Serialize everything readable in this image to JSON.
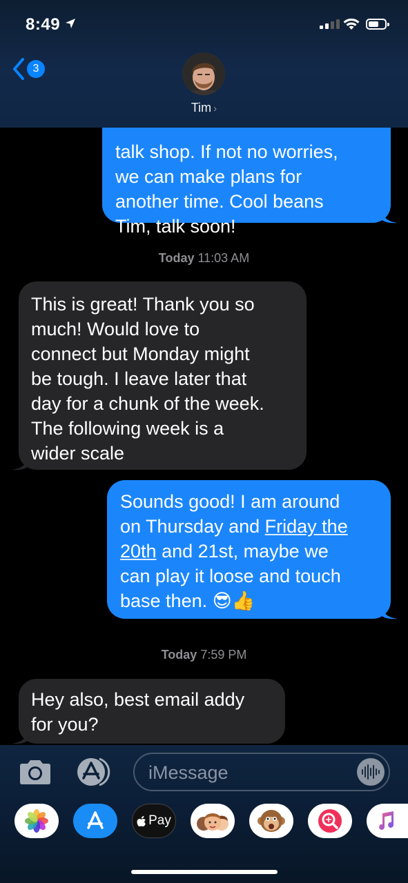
{
  "status": {
    "time": "8:49"
  },
  "header": {
    "back_count": "3",
    "contact_name": "Tim",
    "chevron": "›"
  },
  "messages": {
    "m1": {
      "lines": [
        "talk shop. If not no worries,",
        "we can make plans for",
        "another time. Cool beans",
        "Tim, talk soon!"
      ]
    },
    "ts1": {
      "label": "Today",
      "time": " 11:03 AM"
    },
    "m2": {
      "lines": [
        "This is great! Thank you so",
        "much! Would love to",
        "connect but Monday might",
        "be tough. I leave later that",
        "day for a chunk of the week.",
        "The following week is a",
        "wider scale"
      ]
    },
    "m3": {
      "line1": "Sounds good! I am around",
      "line2_a": "on Thursday and ",
      "line2_link": "Friday the",
      "line3_link": "20th",
      "line3_b": " and 21st, maybe we",
      "line4": "can play it loose and touch",
      "line5": "base then. 😎👍"
    },
    "ts2": {
      "label": "Today",
      "time": " 7:59 PM"
    },
    "m4": {
      "lines": [
        "Hey also, best email addy",
        "for you?"
      ]
    }
  },
  "composer": {
    "placeholder": "iMessage"
  },
  "app_tray": {
    "items": [
      {
        "icon": "photos-icon"
      },
      {
        "icon": "app-store-icon"
      },
      {
        "icon": "apple-pay-icon",
        "label": "Pay"
      },
      {
        "icon": "memoji-icon"
      },
      {
        "icon": "animoji-monkey-icon"
      },
      {
        "icon": "gif-search-icon"
      },
      {
        "icon": "music-icon"
      }
    ]
  },
  "colors": {
    "outgoing_bubble": "#1b86fb",
    "incoming_bubble": "#262628",
    "accent": "#0a84ff"
  }
}
